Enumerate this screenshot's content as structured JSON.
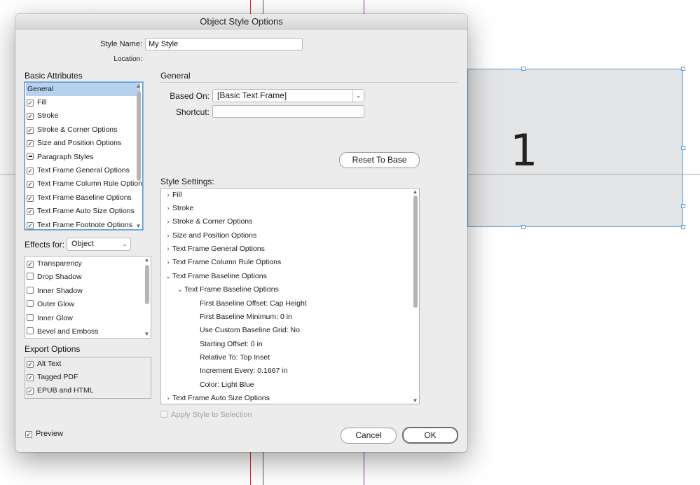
{
  "canvas": {
    "frame_number": "1"
  },
  "dialog": {
    "title": "Object Style Options",
    "style_name_label": "Style Name:",
    "style_name_value": "My Style",
    "location_label": "Location:",
    "basic_attributes": {
      "heading": "Basic Attributes",
      "items": [
        {
          "label": "General",
          "state": "none",
          "selected": true
        },
        {
          "label": "Fill",
          "state": "checked"
        },
        {
          "label": "Stroke",
          "state": "checked"
        },
        {
          "label": "Stroke & Corner Options",
          "state": "checked"
        },
        {
          "label": "Size and Position Options",
          "state": "checked"
        },
        {
          "label": "Paragraph Styles",
          "state": "mixed"
        },
        {
          "label": "Text Frame General Options",
          "state": "checked"
        },
        {
          "label": "Text Frame Column Rule Options",
          "state": "checked"
        },
        {
          "label": "Text Frame Baseline Options",
          "state": "checked"
        },
        {
          "label": "Text Frame Auto Size Options",
          "state": "checked"
        },
        {
          "label": "Text Frame Footnote Options",
          "state": "checked"
        }
      ]
    },
    "effects_for": {
      "label": "Effects for:",
      "value": "Object"
    },
    "effects": {
      "items": [
        {
          "label": "Transparency",
          "state": "checked"
        },
        {
          "label": "Drop Shadow",
          "state": "unchecked"
        },
        {
          "label": "Inner Shadow",
          "state": "unchecked"
        },
        {
          "label": "Outer Glow",
          "state": "unchecked"
        },
        {
          "label": "Inner Glow",
          "state": "unchecked"
        },
        {
          "label": "Bevel and Emboss",
          "state": "unchecked"
        }
      ]
    },
    "export_options": {
      "heading": "Export Options",
      "items": [
        {
          "label": "Alt Text",
          "state": "checked"
        },
        {
          "label": "Tagged PDF",
          "state": "checked"
        },
        {
          "label": "EPUB and HTML",
          "state": "checked"
        }
      ]
    },
    "general": {
      "heading": "General",
      "based_on_label": "Based On:",
      "based_on_value": "[Basic Text Frame]",
      "shortcut_label": "Shortcut:",
      "shortcut_value": "",
      "reset_button": "Reset To Base"
    },
    "style_settings": {
      "heading": "Style Settings:",
      "rows": [
        {
          "label": "Fill",
          "level": 0,
          "expanded": false
        },
        {
          "label": "Stroke",
          "level": 0,
          "expanded": false
        },
        {
          "label": "Stroke & Corner Options",
          "level": 0,
          "expanded": false
        },
        {
          "label": "Size and Position Options",
          "level": 0,
          "expanded": false
        },
        {
          "label": "Text Frame General Options",
          "level": 0,
          "expanded": false
        },
        {
          "label": "Text Frame Column Rule Options",
          "level": 0,
          "expanded": false
        },
        {
          "label": "Text Frame Baseline Options",
          "level": 0,
          "expanded": true
        },
        {
          "label": "Text Frame Baseline Options",
          "level": 1,
          "expanded": true
        },
        {
          "label": "First Baseline Offset: Cap Height",
          "level": 2
        },
        {
          "label": "First Baseline Minimum: 0 in",
          "level": 2
        },
        {
          "label": "Use Custom Baseline Grid: No",
          "level": 2
        },
        {
          "label": "Starting Offset: 0 in",
          "level": 2
        },
        {
          "label": "Relative To: Top Inset",
          "level": 2
        },
        {
          "label": "Increment Every: 0.1667 in",
          "level": 2
        },
        {
          "label": "Color: Light Blue",
          "level": 2
        },
        {
          "label": "Text Frame Auto Size Options",
          "level": 0,
          "expanded": false
        }
      ]
    },
    "apply_style_label": "Apply Style to Selection",
    "preview_label": "Preview",
    "cancel_button": "Cancel",
    "ok_button": "OK"
  },
  "colors": {
    "selection": "#b8d1f0",
    "frame_fill": "#e3e4e6",
    "frame_border": "#5b9bd5",
    "guide_red": "#d9302f",
    "guide_purple": "#8b2fc9"
  }
}
